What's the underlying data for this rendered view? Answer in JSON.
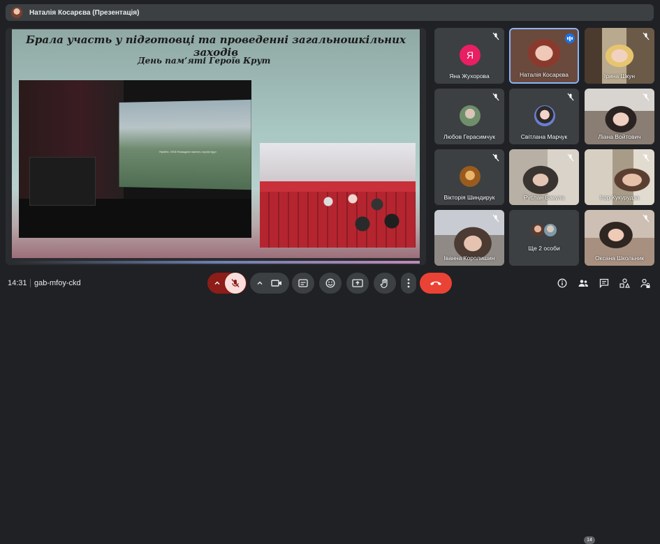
{
  "header": {
    "presenter_title": "Наталія Косарєва (Презентація)"
  },
  "slide": {
    "heading": "Брала участь у підготовці та проведенні загальношкільних заходів",
    "subheading": "День пам’яті Героїв Крут",
    "screen_caption": "Україна, 1918 Ніхаждати пам'ять героїв Крут"
  },
  "participants": [
    {
      "name": "Яна Жухорова",
      "initial": "Я",
      "muted": true,
      "type": "letter"
    },
    {
      "name": "Наталія Косарєва",
      "muted": false,
      "speaking": true,
      "type": "video"
    },
    {
      "name": "Ірина Шкун",
      "muted": true,
      "type": "video"
    },
    {
      "name": "Любов Герасимчук",
      "muted": true,
      "type": "photo"
    },
    {
      "name": "Світлана Марчук",
      "muted": true,
      "type": "photo"
    },
    {
      "name": "Ліана Войтович",
      "muted": true,
      "type": "video"
    },
    {
      "name": "Вікторія Шиндирук",
      "muted": true,
      "type": "photo"
    },
    {
      "name": "Руслан Вакула",
      "muted": true,
      "type": "video"
    },
    {
      "name": "Ігор Кукурудза",
      "muted": true,
      "type": "video"
    },
    {
      "name": "Іванна Королишин",
      "muted": true,
      "type": "video"
    },
    {
      "name": "Ще 2 особи",
      "muted": false,
      "type": "others"
    },
    {
      "name": "Оксана Школьник",
      "muted": true,
      "type": "video"
    }
  ],
  "bottom": {
    "time": "14:31",
    "meeting_code": "gab-mfoy-ckd",
    "people_count": "14"
  },
  "colors": {
    "background": "#202124",
    "tile": "#3c4043",
    "end_call": "#ea4335",
    "active_border": "#8ab4f8",
    "mic_off": "#f9dedc"
  }
}
